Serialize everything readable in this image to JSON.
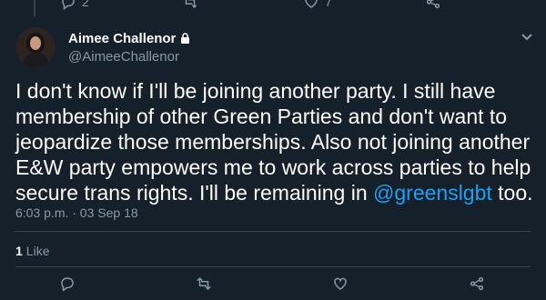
{
  "previous_tweet_actions": {
    "reply_count": "2",
    "retweet_count": "",
    "like_count": "7"
  },
  "tweet": {
    "author": {
      "display_name": "Aimee Challenor",
      "handle": "@AimeeChallenor",
      "protected_icon": "lock-icon"
    },
    "text_before_mention": "I don't know if I'll be joining another party. I still have\nmembership of other Green Parties and don't want to\njeopardize those memberships. Also not joining another\nE&W party empowers me to work across parties to help\nsecure trans rights. I'll be remaining in ",
    "mention": "@greenslgbt",
    "text_after_mention": " too.",
    "timestamp": "6:03 p.m. · 03 Sep 18",
    "likes": {
      "count": "1",
      "label": "Like"
    }
  },
  "actions": {
    "reply_icon": "reply-icon",
    "retweet_icon": "retweet-icon",
    "like_icon": "heart-icon",
    "share_icon": "share-icon"
  },
  "colors": {
    "background": "#15202b",
    "text": "#ffffff",
    "secondary": "#8899a6",
    "accent": "#1da1f2",
    "divider": "#38444d"
  }
}
